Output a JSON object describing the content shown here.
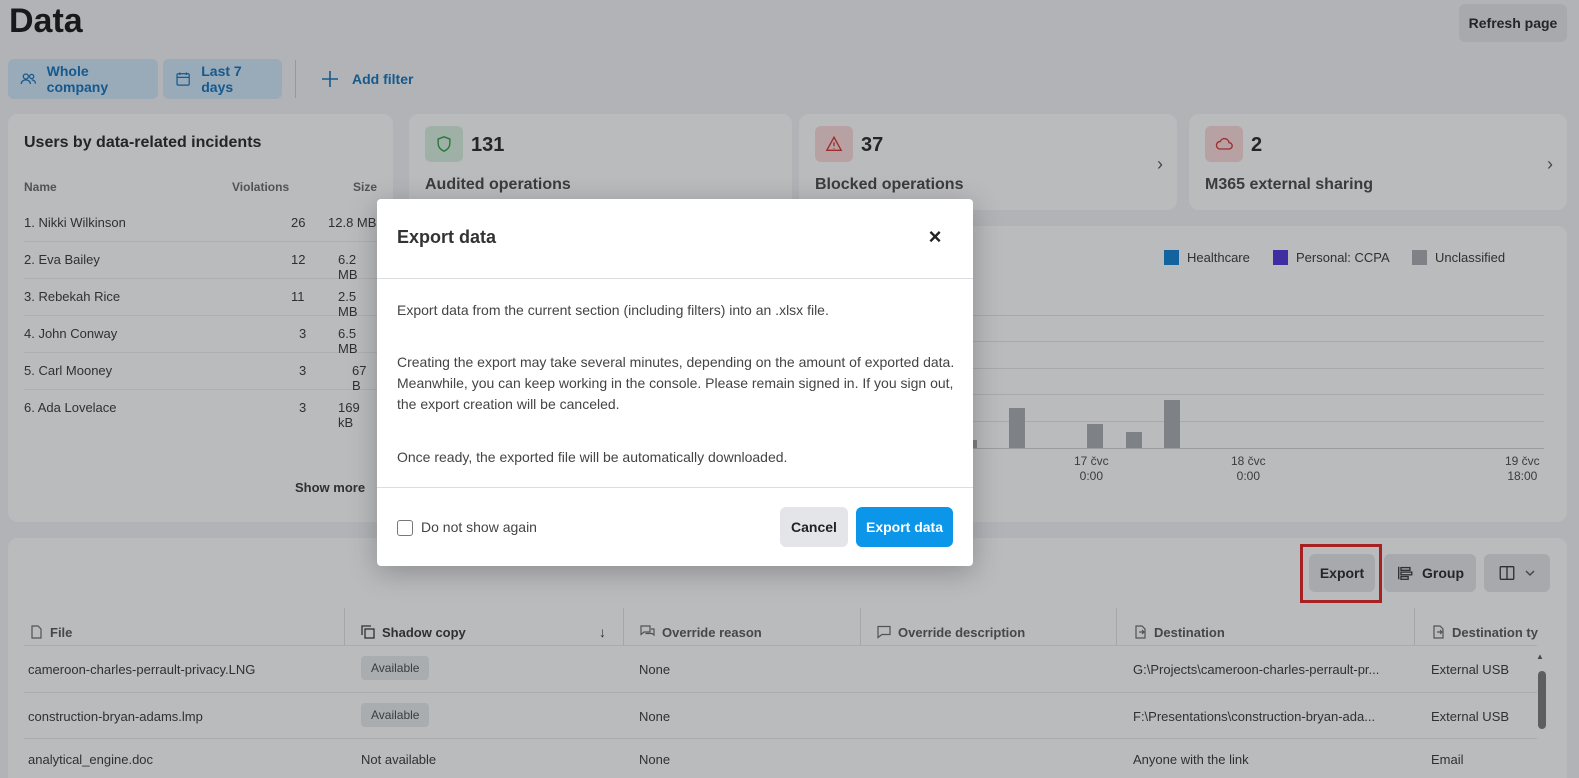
{
  "header": {
    "title": "Data",
    "refresh_label": "Refresh page"
  },
  "filters": {
    "company_label": "Whole company",
    "date_label": "Last 7 days",
    "add_filter_label": "Add filter"
  },
  "users_card": {
    "title": "Users by data-related incidents",
    "columns": [
      "Name",
      "Violations",
      "Size"
    ],
    "rows": [
      {
        "name": "1. Nikki Wilkinson",
        "violations": "26",
        "size": "12.8 MB"
      },
      {
        "name": "2. Eva Bailey",
        "violations": "12",
        "size": "6.2 MB"
      },
      {
        "name": "3. Rebekah Rice",
        "violations": "11",
        "size": "2.5 MB"
      },
      {
        "name": "4. John Conway",
        "violations": "3",
        "size": "6.5 MB"
      },
      {
        "name": "5. Carl Mooney",
        "violations": "3",
        "size": "67 B"
      },
      {
        "name": "6. Ada Lovelace",
        "violations": "3",
        "size": "169 kB"
      }
    ],
    "show_more": "Show more"
  },
  "stats": [
    {
      "value": "131",
      "label": "Audited operations",
      "icon": "shield-icon",
      "color": "#2e9e46",
      "bg": "#d8f1dd"
    },
    {
      "value": "37",
      "label": "Blocked operations",
      "icon": "warning-icon",
      "color": "#d22f2f",
      "bg": "#fbd9d9"
    },
    {
      "value": "2",
      "label": "M365 external sharing",
      "icon": "cloud-icon",
      "color": "#d22f2f",
      "bg": "#fbd9d9"
    }
  ],
  "chart": {
    "legend": [
      {
        "name": "Healthcare",
        "color": "#0a7fd1"
      },
      {
        "name": "Personal: CCPA",
        "color": "#4b2fd8"
      },
      {
        "name": "Unclassified",
        "color": "#a7aaad"
      }
    ],
    "x_ticks": [
      {
        "line1": "17 čvc",
        "line2": "0:00"
      },
      {
        "line1": "18 čvc",
        "line2": "0:00"
      },
      {
        "line1": "19 čvc",
        "line2": "18:00"
      }
    ]
  },
  "chart_data": {
    "type": "bar",
    "series": [
      {
        "name": "Unclassified",
        "values": [
          1,
          5,
          3,
          2,
          6
        ]
      }
    ],
    "legend": [
      "Healthcare",
      "Personal: CCPA",
      "Unclassified"
    ],
    "x_tick_labels": [
      "17 čvc 0:00",
      "18 čvc 0:00",
      "19 čvc 18:00"
    ]
  },
  "table": {
    "toolbar": {
      "export_label": "Export",
      "group_label": "Group"
    },
    "columns": [
      "File",
      "Shadow copy",
      "Override reason",
      "Override description",
      "Destination",
      "Destination ty"
    ],
    "rows": [
      {
        "file": "cameroon-charles-perrault-privacy.LNG",
        "shadow": "Available",
        "shadow_pill": true,
        "reason": "None",
        "description": "",
        "destination": "G:\\Projects\\cameroon-charles-perrault-pr...",
        "dest_type": "External USB"
      },
      {
        "file": "construction-bryan-adams.lmp",
        "shadow": "Available",
        "shadow_pill": true,
        "reason": "None",
        "description": "",
        "destination": "F:\\Presentations\\construction-bryan-ada...",
        "dest_type": "External USB"
      },
      {
        "file": "analytical_engine.doc",
        "shadow": "Not available",
        "shadow_pill": false,
        "reason": "None",
        "description": "",
        "destination": "Anyone with the link",
        "dest_type": "Email"
      }
    ]
  },
  "modal": {
    "title": "Export data",
    "p1": "Export data from the current section (including filters) into an .xlsx file.",
    "p2": "Creating the export may take several minutes, depending on the amount of exported data. Meanwhile, you can keep working in the console. Please remain signed in. If you sign out, the export creation will be canceled.",
    "p3": "Once ready, the exported file will be automatically downloaded.",
    "checkbox_label": "Do not show again",
    "cancel_label": "Cancel",
    "export_label": "Export data"
  }
}
